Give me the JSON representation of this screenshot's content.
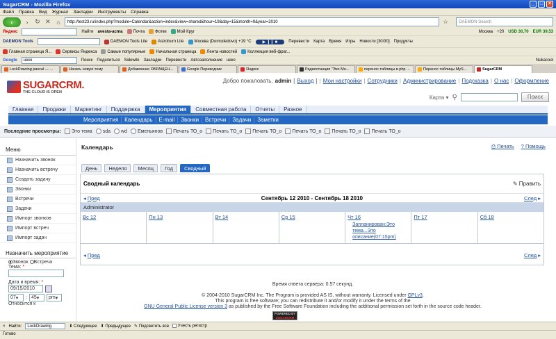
{
  "window": {
    "title": "SugarCRM - Mozilla Firefox"
  },
  "menubar": [
    "Файл",
    "Правка",
    "Вид",
    "Журнал",
    "Закладки",
    "Инструменты",
    "Справка"
  ],
  "nav": {
    "back_glyph": "‹",
    "url": "http://test23.ru/index.php?module=Calendar&action=index&view=shared&hour=19&day=15&month=9&year=2010",
    "search_placeholder": "DAEMON Search"
  },
  "yandex_bar": {
    "brand": "Яндекс",
    "find_label": "Найти",
    "mail": "Почта",
    "photo": "Фотки",
    "my_circle": "Мой Круг",
    "user": "avesta-acma",
    "city": "Москва",
    "temp": "+20",
    "usd": "USD 30,70",
    "eur": "EUR 39,53"
  },
  "daemon_bar": {
    "brand": "DAEMON Tools",
    "daemon_lite": "DAEMON Tools Lite",
    "astroburn": "Astroburn Lite",
    "weather": "Москва (Domodedovo) +19 °C",
    "translate": "Перевести",
    "map": "Карта",
    "time": "Время",
    "games": "Игры",
    "news": "Новости [30/30]",
    "products": "Продукты"
  },
  "bookmarks_bar": {
    "items": [
      "Главная страница Я...",
      "Сервисы Яндекса",
      "Самые популярные",
      "Начальная страница",
      "Лента новостей",
      "Коллекция веб-фраг..."
    ]
  },
  "google_bar": {
    "brand": "Google",
    "query": "неко",
    "search": "Поиск",
    "share": "Поделиться",
    "sidewiki": "Sidewiki",
    "bookmarks": "Закладки",
    "translate": "Перевести",
    "autofill": "Автозаполнение",
    "nero": "неко",
    "user": "Nukacool"
  },
  "browser_tabs": [
    {
      "label": "LockDrawing pascal — ...",
      "active": false
    },
    {
      "label": "Начать новую тему",
      "active": false
    },
    {
      "label": "Добавление ОБРАЩЕН...",
      "active": false
    },
    {
      "label": "Google Переводчик",
      "active": false
    },
    {
      "label": "Яндекс",
      "active": false
    },
    {
      "label": "Радиостанция \"Эхо Мо...",
      "active": false
    },
    {
      "label": "перенос таблицы в php ...",
      "active": false
    },
    {
      "label": "Перенос таблицы MyS...",
      "active": false
    },
    {
      "label": "SugarCRM",
      "active": true
    }
  ],
  "sugar": {
    "logo_text": "SUGARCRM.",
    "logo_tagline": "THE CLOUD IS OPEN",
    "welcome": "Добро пожаловать,",
    "username": "admin",
    "logout": "Выход",
    "links": [
      "Мои настройки",
      "Сотрудники",
      "Администрирование",
      "Подсказка",
      "О нас",
      "Оформление"
    ],
    "map_label": "Карта",
    "search_button": "Поиск",
    "main_nav": [
      {
        "label": "Главная",
        "active": false
      },
      {
        "label": "Продажи",
        "active": false
      },
      {
        "label": "Маркетинг",
        "active": false
      },
      {
        "label": "Поддержка",
        "active": false
      },
      {
        "label": "Мероприятия",
        "active": true
      },
      {
        "label": "Совместная работа",
        "active": false
      },
      {
        "label": "Отчеты",
        "active": false
      },
      {
        "label": "Разное",
        "active": false
      }
    ],
    "sub_nav": [
      "Мероприятия",
      "Календарь",
      "E-mail",
      "Звонки",
      "Встречи",
      "Задачи",
      "Заметки"
    ],
    "recent_label": "Последние просмотры:",
    "recent_items": [
      "Это тема",
      "sda",
      "wd",
      "Емельянов",
      "Печать ТО_о",
      "Печать ТО_о",
      "Печать ТО_о",
      "Печать ТО_о",
      "Печать ТО_о",
      "Печать ТО_о"
    ],
    "sidebar": {
      "title": "Меню",
      "items": [
        "Назначить звонок",
        "Назначить встречу",
        "Создать задачу",
        "Звонки",
        "Встречи",
        "Задачи",
        "Импорт звонков",
        "Импорт встреч",
        "Импорт задач"
      ],
      "quick_title": "Назначить мероприятие",
      "radio_call": "Звонок",
      "radio_meeting": "Встреча",
      "subject_label": "Тема:",
      "datetime_label": "Дата и время:",
      "date_value": "09/15/2010",
      "hour_value": "07",
      "minute_value": "45",
      "ampm_value": "pm",
      "duration_label": "Относится к"
    },
    "calendar": {
      "title": "Календарь",
      "print": "Печать",
      "help": "Помощь",
      "views": [
        {
          "label": "День",
          "active": false
        },
        {
          "label": "Неделя",
          "active": false
        },
        {
          "label": "Месяц",
          "active": false
        },
        {
          "label": "Год",
          "active": false
        },
        {
          "label": "Сводный",
          "active": true
        }
      ],
      "panel_title": "Сводный календарь",
      "edit": "Править",
      "prev": "Пред",
      "next": "След",
      "range": "Сентябрь 12 2010 - Сентябрь 18 2010",
      "user_row": "Administrator",
      "days": [
        "Вс 12",
        "Пн 13",
        "Вт 14",
        "Ср 15",
        "Чт 16",
        "Пт 17",
        "Сб 18"
      ],
      "event_text": "Запланирован:Это тема...Это описание(07:15pm)"
    },
    "footer": {
      "response": "Время ответа сервера: 0.57 секунд.",
      "line1": "© 2004-2010 SugarCRM Inc. The Program is provided AS IS, without warranty. Licensed under",
      "gpl": "GPLv3",
      "line2": "This program is free software; you can redistribute it and/or modify it under the terms of the",
      "gnu_link": "GNU General Public License version 3",
      "line3": "as published by the Free Software Foundation including the additional permission set forth in the source code header.",
      "powered_top": "POWERED BY",
      "powered_bottom": "SUGARCRM"
    }
  },
  "findbar": {
    "label": "Найти:",
    "value": "LockDrawing",
    "next": "Следующее",
    "prev": "Предыдущее",
    "highlight": "Подсветить все",
    "match_case": "Учесть регистр"
  },
  "status": {
    "text": "Готово"
  }
}
